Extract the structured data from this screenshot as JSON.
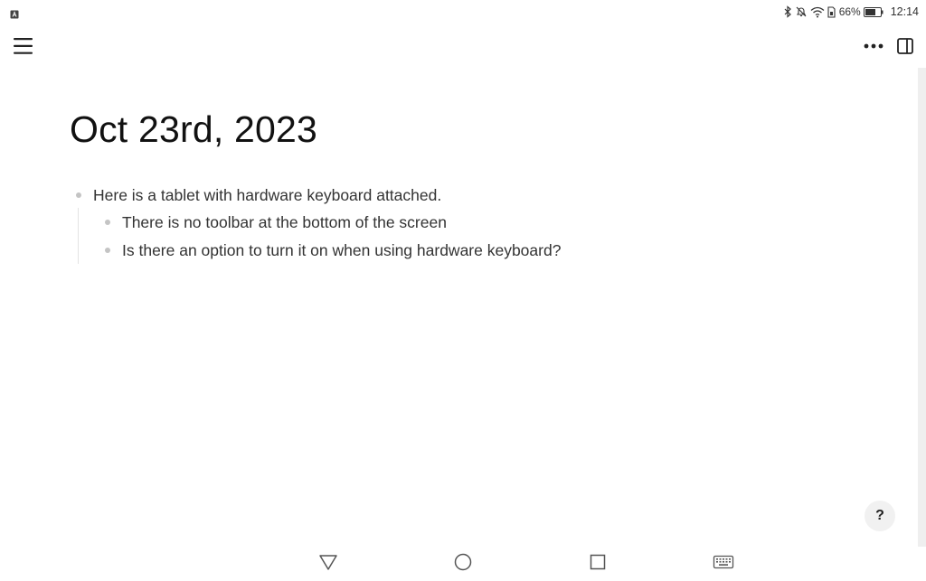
{
  "status_bar": {
    "battery_percent": "66%",
    "time": "12:14",
    "icons": [
      "notification-icon",
      "bluetooth-icon",
      "mute-icon",
      "wifi-icon",
      "sim-icon",
      "battery-icon"
    ]
  },
  "toolbar": {
    "icons": [
      "menu-icon",
      "more-icon",
      "sidebar-panel-icon"
    ]
  },
  "page": {
    "title": "Oct 23rd, 2023",
    "blocks": [
      {
        "text": "Here is a tablet with hardware keyboard attached.",
        "level": 0
      },
      {
        "text": "There is no toolbar at the bottom of the screen",
        "level": 1
      },
      {
        "text": "Is there an option to turn it on when using hardware keyboard?",
        "level": 1
      }
    ]
  },
  "help": {
    "label": "?"
  },
  "nav_bar": {
    "icons": [
      "back-icon",
      "home-icon",
      "recents-icon",
      "keyboard-icon"
    ]
  }
}
